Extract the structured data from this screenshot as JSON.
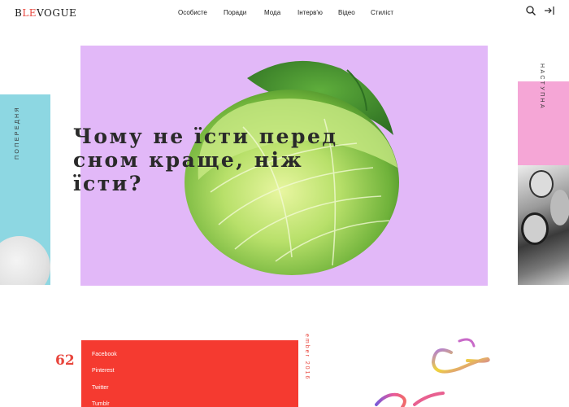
{
  "header": {
    "logo_prefix": "B",
    "logo_accent": "LE",
    "logo_suffix": "VOGUE",
    "nav": [
      "Особисте",
      "Поради",
      "Мода",
      "Інтерв'ю",
      "Відео",
      "Стиліст"
    ],
    "icons": [
      "search-icon",
      "login-icon"
    ]
  },
  "prev": {
    "label": "ПОПЕРЕДНЯ"
  },
  "next": {
    "label": "НАСТУПНА"
  },
  "hero": {
    "title": "Чому не їсти перед сном краще, ніж їсти?"
  },
  "share": {
    "count": "62",
    "links": [
      "Facebook",
      "Pinterest",
      "Twitter",
      "Tumblr"
    ]
  },
  "date": "ember 2016",
  "colors": {
    "accent": "#e8453c",
    "hero_bg": "#e2b8f8",
    "prev_bg": "#8dd7e2",
    "next_bg": "#f5a6d6",
    "social_bg": "#f53a30"
  }
}
